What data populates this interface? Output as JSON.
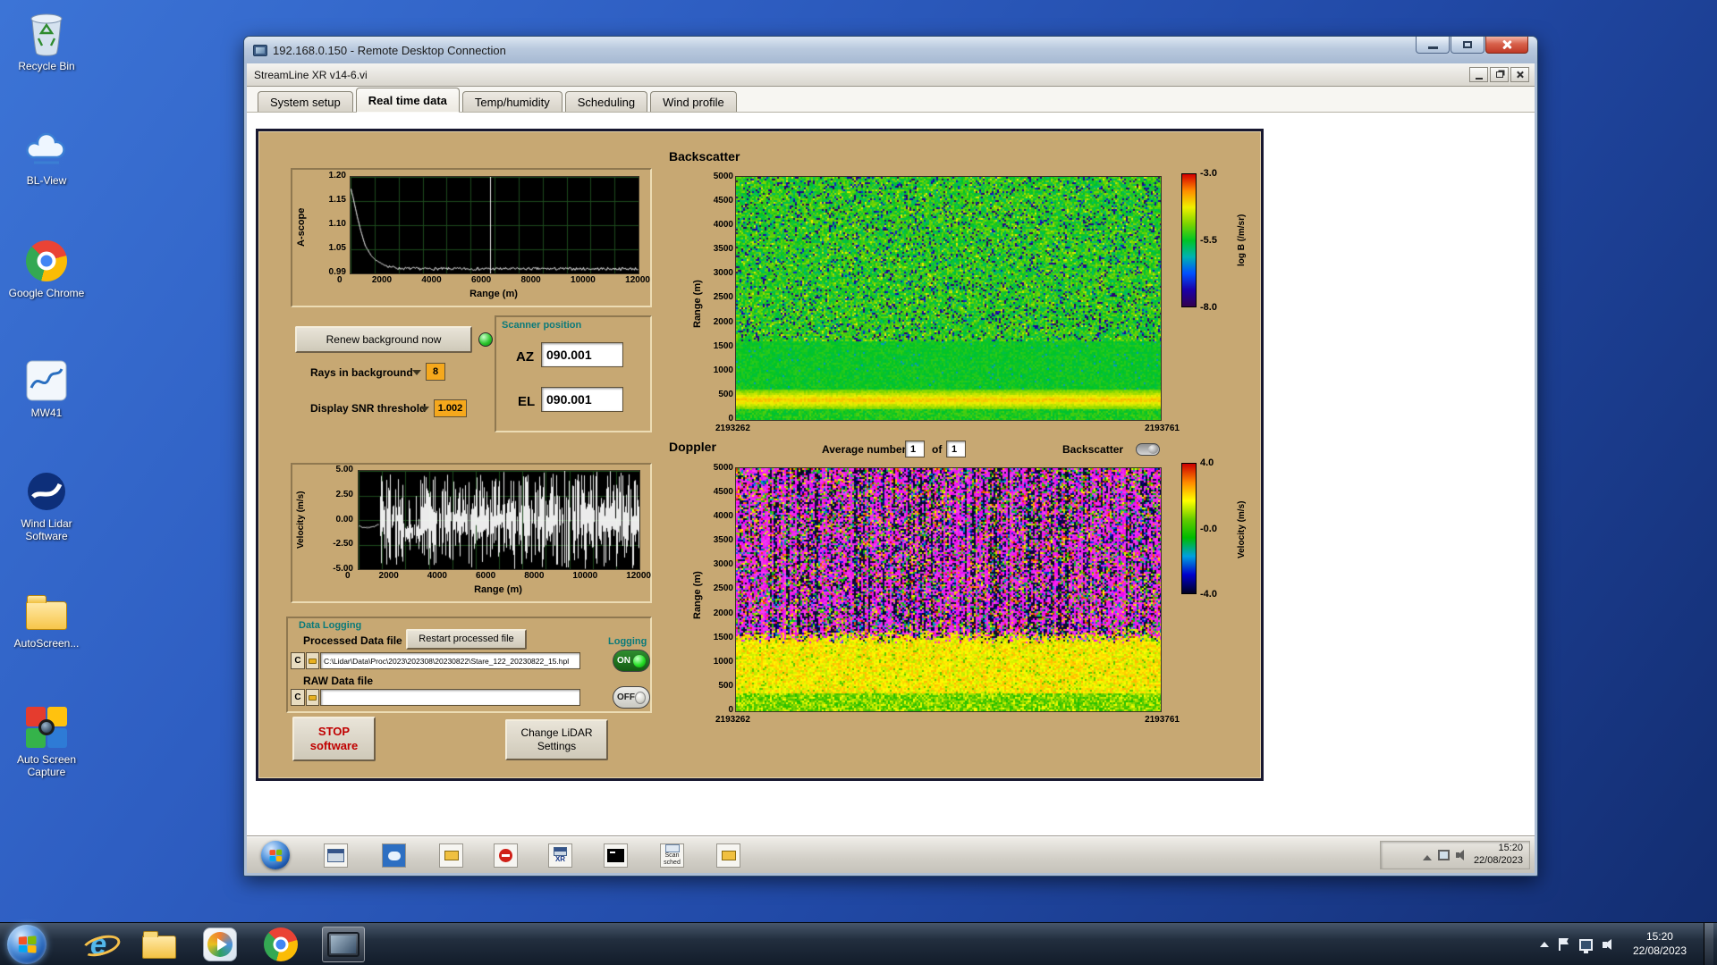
{
  "desktop": {
    "icons": [
      {
        "label": "Recycle Bin"
      },
      {
        "label": "BL-View"
      },
      {
        "label": "Google Chrome"
      },
      {
        "label": "MW41"
      },
      {
        "label": "Wind Lidar Software"
      },
      {
        "label": "AutoScreen..."
      },
      {
        "label": "Auto Screen Capture"
      }
    ]
  },
  "rdp_window": {
    "title": "192.168.0.150 - Remote Desktop Connection"
  },
  "app_window": {
    "title": "StreamLine XR v14-6.vi",
    "active_tab": "Real time data",
    "tabs": [
      "System setup",
      "Real time data",
      "Temp/humidity",
      "Scheduling",
      "Wind profile"
    ]
  },
  "panel": {
    "backscatter_heading": "Backscatter",
    "doppler_heading": "Doppler",
    "renew_button": "Renew background now",
    "rays_label": "Rays in background",
    "rays_value": "8",
    "snr_label": "Display SNR threshold",
    "snr_value": "1.002",
    "scanner": {
      "title": "Scanner position",
      "az_label": "AZ",
      "az_value": "090.001",
      "el_label": "EL",
      "el_value": "090.001"
    },
    "average_label": "Average number",
    "average_value": "1",
    "of_label": "of",
    "of_value": "1",
    "backscatter_toggle_label": "Backscatter",
    "logging": {
      "title": "Data Logging",
      "processed_label": "Processed Data file",
      "restart_button": "Restart processed file",
      "logging_label": "Logging",
      "drive_label": "C",
      "processed_path": "C:\\Lidar\\Data\\Proc\\2023\\202308\\20230822\\Stare_122_20230822_15.hpl",
      "on_label": "ON",
      "raw_label": "RAW Data file",
      "raw_path": "",
      "off_label": "OFF"
    },
    "stop_button_line1": "STOP",
    "stop_button_line2": "software",
    "change_button_line1": "Change LiDAR",
    "change_button_line2": "Settings"
  },
  "remote_taskbar": {
    "time": "15:20",
    "date": "22/08/2023",
    "icons": [
      {
        "name": "start-orb"
      },
      {
        "name": "app-window"
      },
      {
        "name": "app-viewer"
      },
      {
        "name": "app-folder"
      },
      {
        "name": "app-record"
      },
      {
        "name": "app-xr",
        "label": "XR"
      },
      {
        "name": "console"
      },
      {
        "name": "scan-scheduler",
        "label": "Scan sched"
      },
      {
        "name": "file-explorer"
      }
    ]
  },
  "host_taskbar": {
    "time": "15:20",
    "date": "22/08/2023",
    "ie_glyph": "e"
  },
  "chart_data": [
    {
      "id": "ascope",
      "type": "line",
      "title": "Background A-scope vs range",
      "ylabel": "A-scope",
      "xlabel": "Range (m)",
      "xlim": [
        0,
        12000
      ],
      "ylim": [
        0.99,
        1.2
      ],
      "yticks": [
        "1.20",
        "1.15",
        "1.10",
        "1.05",
        "0.99"
      ],
      "xticks": [
        "0",
        "2000",
        "4000",
        "6000",
        "8000",
        "10000",
        "12000"
      ],
      "bg": "#000000",
      "grid_color": "#1d4a1d",
      "line_color": "#ffffff",
      "series": [
        {
          "name": "a-scope-trace",
          "x": [
            0,
            150,
            300,
            450,
            600,
            800,
            1000,
            1300,
            1600,
            2000,
            3000,
            4000,
            5000,
            6000,
            7000,
            8000,
            9000,
            10000,
            11000,
            12000
          ],
          "y": [
            1.175,
            1.14,
            1.105,
            1.075,
            1.05,
            1.032,
            1.02,
            1.01,
            1.005,
            1.001,
            1.0,
            1.0,
            1.0,
            1.0,
            1.0,
            1.0,
            1.0,
            1.0,
            1.0,
            1.0
          ]
        }
      ],
      "annotations": [
        {
          "type": "vline",
          "x": 5800
        }
      ]
    },
    {
      "id": "backscatter",
      "type": "heatmap",
      "title": "Backscatter",
      "ylabel": "Range (m)",
      "ylim": [
        0,
        5000
      ],
      "yticks": [
        "5000",
        "4500",
        "4000",
        "3500",
        "3000",
        "2500",
        "2000",
        "1500",
        "1000",
        "500",
        "0"
      ],
      "x_start": "2193262",
      "x_end": "2193761",
      "colorbar": {
        "label": "log B (/m/sr)",
        "ticks": [
          "-3.0",
          "-5.5",
          "-8.0"
        ],
        "min": -8.0,
        "max": -3.0,
        "stops": [
          "#d40000",
          "#ff8c00",
          "#f0f000",
          "#7cd400",
          "#00c426",
          "#00b2b2",
          "#0050ff",
          "#1a00a8",
          "#33004d"
        ]
      },
      "layers": [
        {
          "range_m": [
            1650,
            5000
          ],
          "value": -5.5,
          "texture": "green speckle noise with dark and yellow flecks"
        },
        {
          "range_m": [
            650,
            1650
          ],
          "value": -5.45,
          "texture": "smooth green"
        },
        {
          "range_m": [
            240,
            650
          ],
          "value": -4.1,
          "texture": "bright yellow aerosol band"
        },
        {
          "range_m": [
            0,
            240
          ],
          "value": -5.3,
          "texture": "green"
        }
      ]
    },
    {
      "id": "velocity",
      "type": "line",
      "title": "Doppler velocity vs range",
      "ylabel": "Velocity (m/s)",
      "xlabel": "Range (m)",
      "xlim": [
        0,
        12000
      ],
      "ylim": [
        -5,
        5
      ],
      "yticks": [
        "5.00",
        "2.50",
        "0.00",
        "-2.50",
        "-5.00"
      ],
      "xticks": [
        "0",
        "2000",
        "4000",
        "6000",
        "8000",
        "10000",
        "12000"
      ],
      "bg": "#000000",
      "grid_color": "#1d4a1d",
      "line_color": "#ffffff",
      "description": "Smooth trace near -0.5 m/s below ~900 m; saturated random noise bars spanning ±5 m/s from ~900 m to 12000 m with darker gap around 1900-2600 m"
    },
    {
      "id": "doppler",
      "type": "heatmap",
      "title": "Doppler",
      "ylabel": "Range (m)",
      "ylim": [
        0,
        5000
      ],
      "yticks": [
        "5000",
        "4500",
        "4000",
        "3500",
        "3000",
        "2500",
        "2000",
        "1500",
        "1000",
        "500",
        "0"
      ],
      "x_start": "2193262",
      "x_end": "2193761",
      "colorbar": {
        "label": "Velocity (m/s)",
        "ticks": [
          "4.0",
          "-0.0",
          "-4.0"
        ],
        "min": -4.0,
        "max": 4.0,
        "stops": [
          "#cc0000",
          "#ff8800",
          "#ffff00",
          "#66cc00",
          "#00bb00",
          "#00a0e0",
          "#0000cc",
          "#000022"
        ],
        "over_color": "#ff00ff",
        "under_color": "#000010"
      },
      "layers": [
        {
          "range_m": [
            1700,
            5000
          ],
          "texture": "fold-over noise: magenta/black/green speckle with vertical streaks"
        },
        {
          "range_m": [
            380,
            1700
          ],
          "value": 1.8,
          "texture": "yellow aerosol layer"
        },
        {
          "range_m": [
            0,
            380
          ],
          "value": 0.7,
          "texture": "green-yellow mix near ground"
        }
      ]
    }
  ]
}
